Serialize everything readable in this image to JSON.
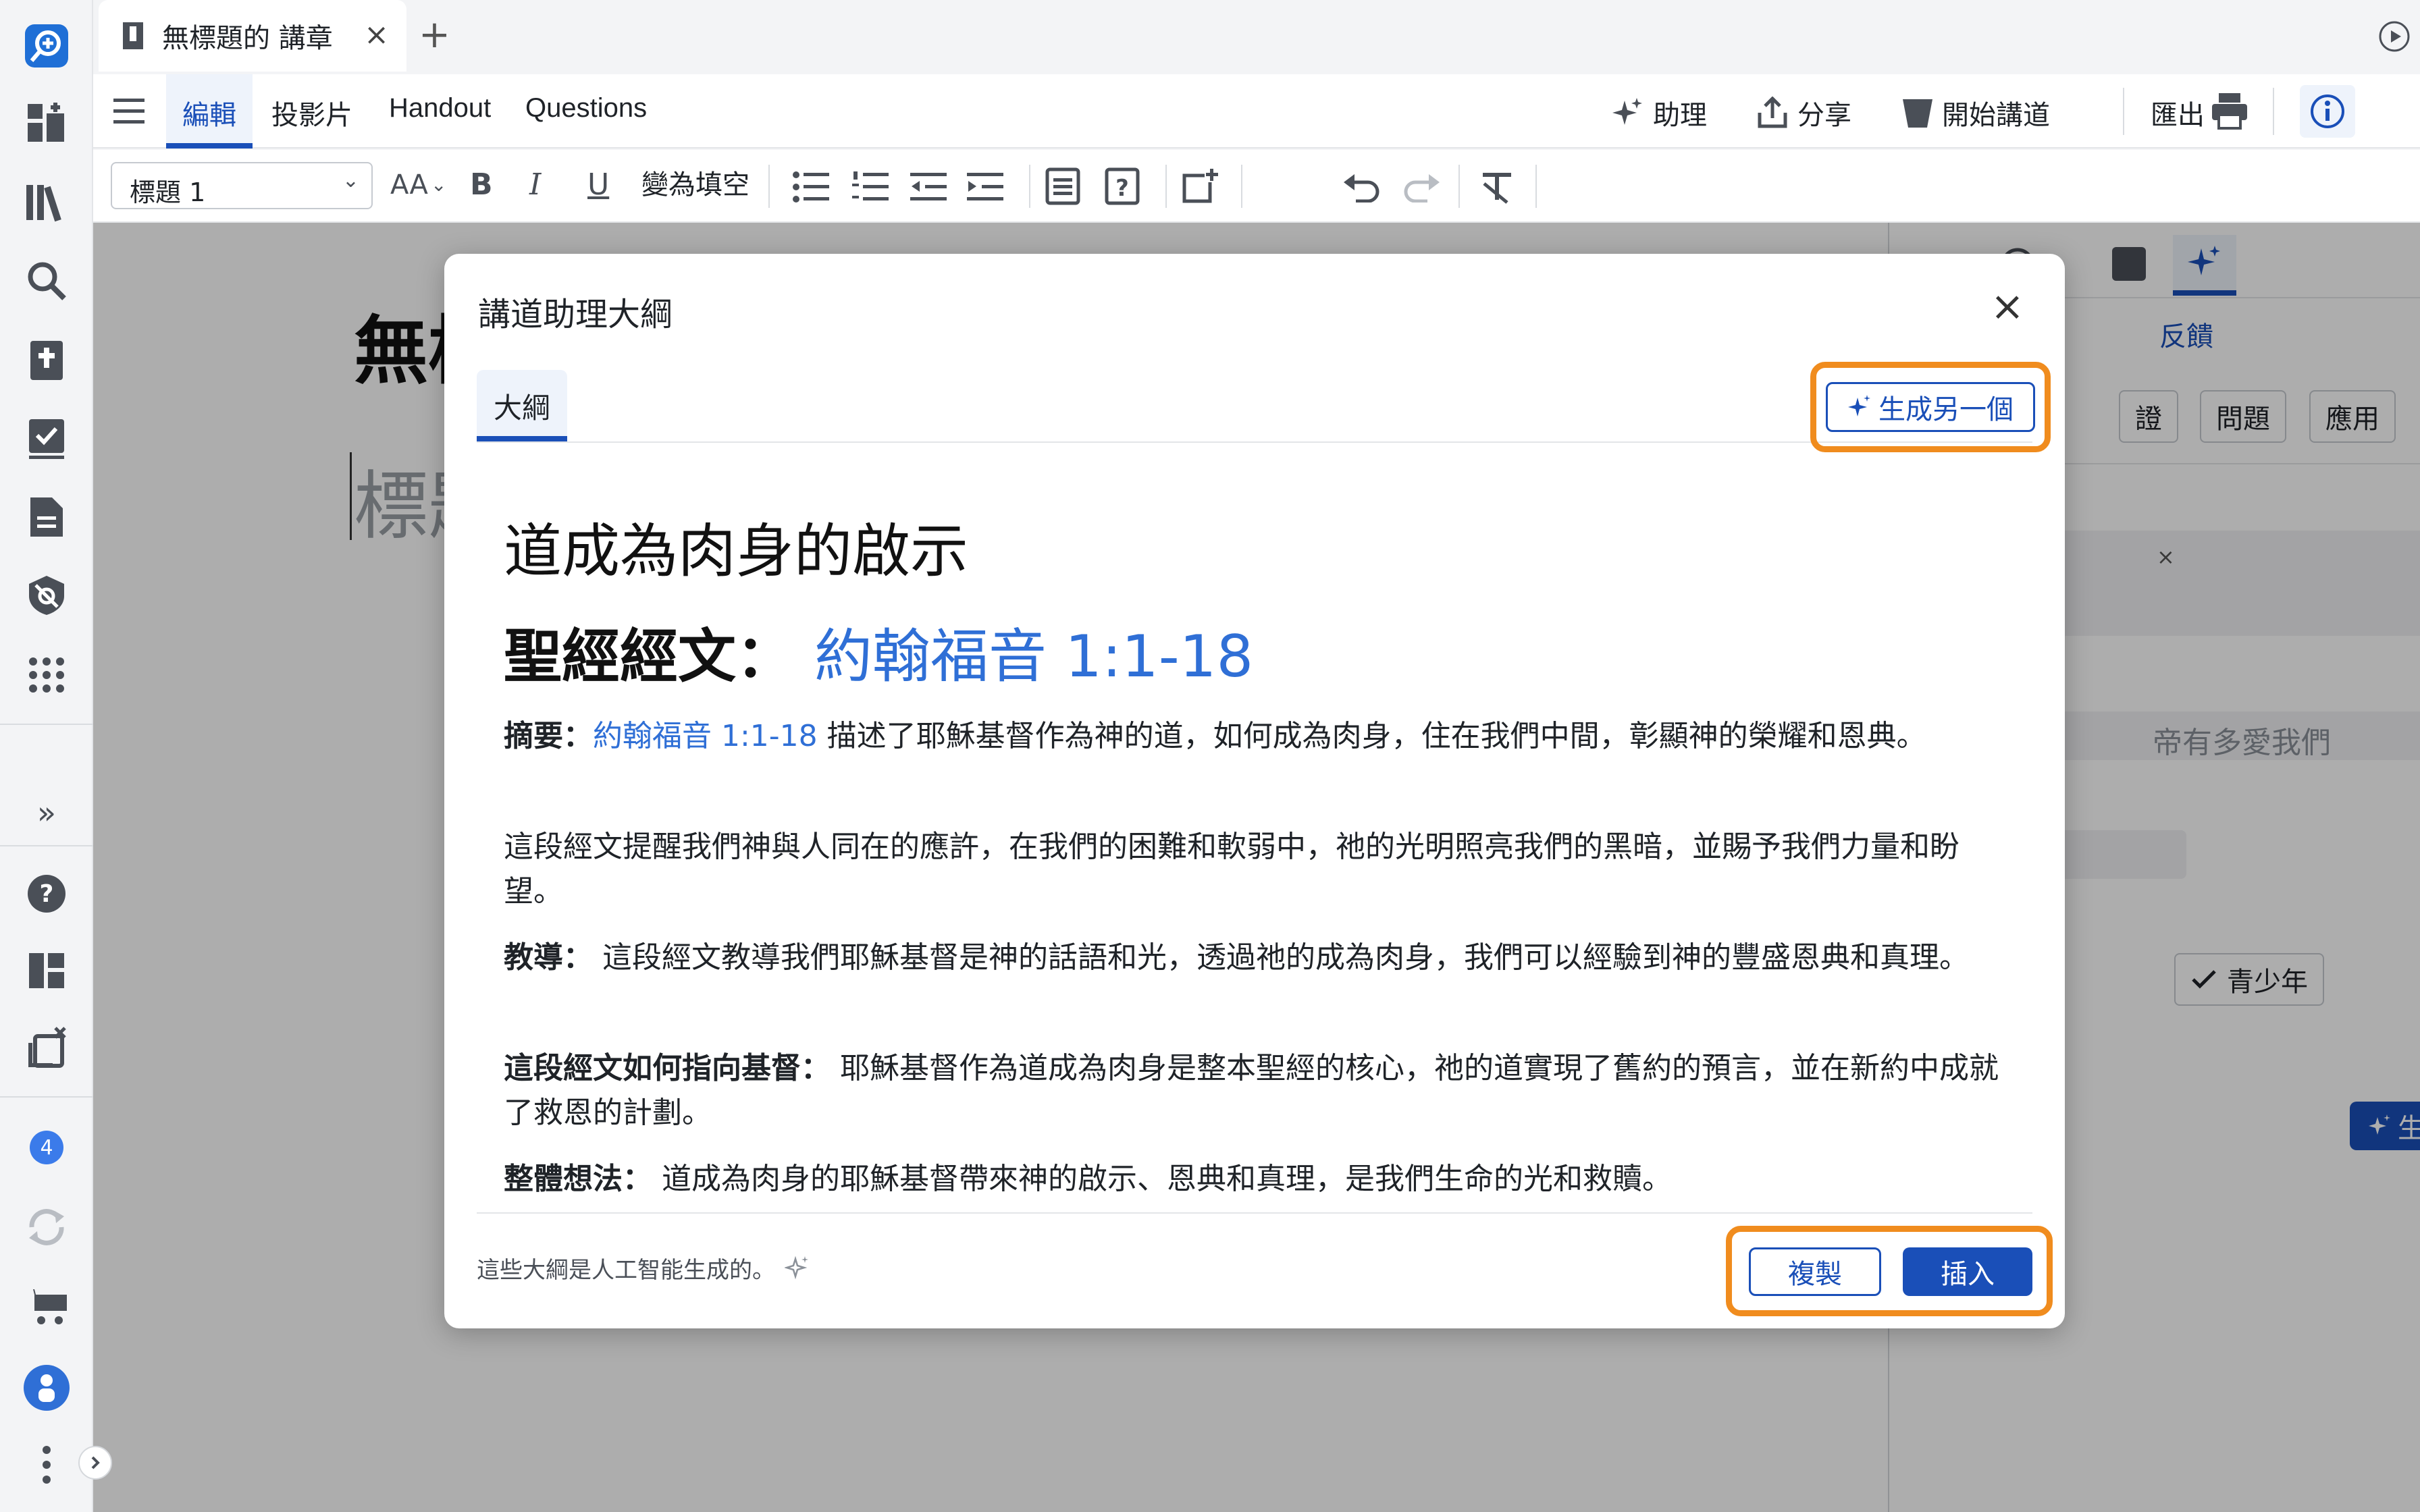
{
  "tab": {
    "title": "無標題的 講章",
    "close": "×",
    "new": "+"
  },
  "menu": {
    "items": [
      "編輯",
      "投影片",
      "Handout",
      "Questions"
    ],
    "assistant": "助理",
    "share": "分享",
    "start_preaching": "開始講道",
    "export": "匯出"
  },
  "toolbar": {
    "style_select": "標題 1",
    "font_size": "AA",
    "bold": "B",
    "italic": "I",
    "underline": "U",
    "cloze": "變為填空"
  },
  "background": {
    "title_fragment": "無標",
    "placeholder_fragment": "標題",
    "right_panel": {
      "feedback": "反饋",
      "chips": [
        "證",
        "問題",
        "應用"
      ],
      "prompt_fragment": "帝有多愛我們",
      "audience": "青少年",
      "generate": "生成",
      "close": "×"
    }
  },
  "modal": {
    "title": "講道助理大綱",
    "close": "×",
    "tab": "大綱",
    "generate_another": "生成另一個",
    "heading": "道成為肉身的啟示",
    "scripture_label": "聖經經文：",
    "scripture_ref": "約翰福音 1:1-18",
    "summary_label": "摘要：",
    "summary_ref": "約翰福音 1:1-18",
    "summary_text": " 描述了耶穌基督作為神的道，如何成為肉身，住在我們中間，彰顯神的榮耀和恩典。",
    "reminder_text": "這段經文提醒我們神與人同在的應許，在我們的困難和軟弱中，祂的光明照亮我們的黑暗，並賜予我們力量和盼望。",
    "teaching_label": "教導：",
    "teaching_text": " 這段經文教導我們耶穌基督是神的話語和光，透過祂的成為肉身，我們可以經驗到神的豐盛恩典和真理。",
    "christ_label": "這段經文如何指向基督：",
    "christ_text": " 耶穌基督作為道成為肉身是整本聖經的核心，祂的道實現了舊約的預言，並在新約中成就了救恩的計劃。",
    "overall_label": "整體想法：",
    "overall_text": " 道成為肉身的耶穌基督帶來神的啟示、恩典和真理，是我們生命的光和救贖。",
    "footer_note": "這些大綱是人工智能生成的。",
    "copy": "複製",
    "insert": "插入"
  },
  "rail": {
    "badge_count": "4",
    "expand": "»"
  },
  "colors": {
    "accent": "#1a4fb8",
    "highlight": "#f08c1e",
    "link": "#2f6fd6"
  }
}
